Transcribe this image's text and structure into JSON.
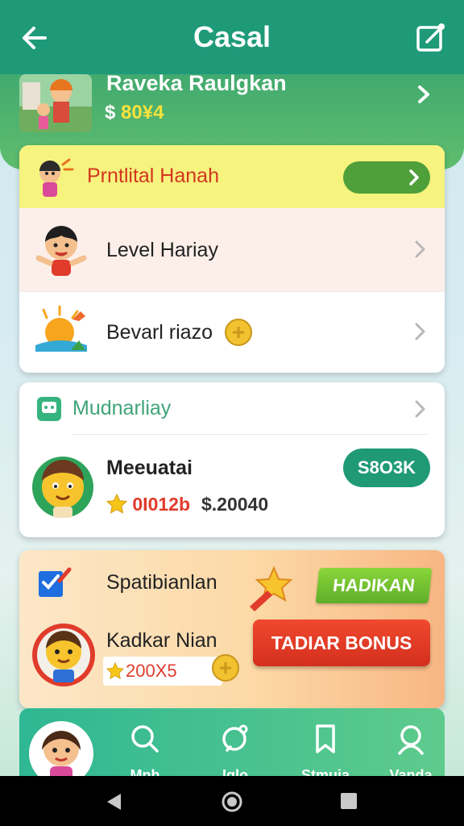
{
  "appbar": {
    "title": "Casal",
    "back_icon": "arrow-left-icon",
    "edit_icon": "edit-icon"
  },
  "profile": {
    "name": "Raveka Raulgkan",
    "currency": "$",
    "balance": "80¥4"
  },
  "list": {
    "header": "Prntlital Hanah",
    "level_label": "Level Hariay",
    "reward_label": "Bevarl riazo"
  },
  "section": {
    "header": "Mudnarliay",
    "user_name": "Meeuatai",
    "points": "0I012b",
    "amount": "$.20040",
    "action": "S8O3K"
  },
  "promo": {
    "title": "Spatibianlan",
    "badge": "HADIKAN",
    "name": "Kadkar Nian",
    "score": "200X5",
    "bonus_button": "TADIAR BONUS"
  },
  "bottom_nav": {
    "items": [
      {
        "label": "Mnh",
        "icon": "search-icon"
      },
      {
        "label": "Iqlo",
        "icon": "search-plus-icon"
      },
      {
        "label": "Stmuia",
        "icon": "bookmark-icon"
      },
      {
        "label": "Vanda",
        "icon": "profile-icon"
      }
    ]
  },
  "colors": {
    "primary": "#1e9a79",
    "accent_green": "#4f9f3b",
    "red": "#e03b2b",
    "yellow": "#f7e23b"
  }
}
